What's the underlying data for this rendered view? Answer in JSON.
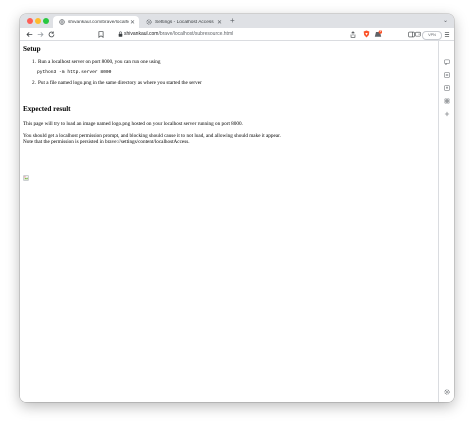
{
  "tabs": [
    {
      "title": "shivankaul.com/brave/localhost/subresource.html",
      "active": true
    },
    {
      "title": "Settings - Localhost Access",
      "active": false
    }
  ],
  "toolbar": {
    "url_host": "shivankaul.com",
    "url_path": "/brave/localhost/subresource.html",
    "vpn_label": "VPN",
    "shields_badge": "1"
  },
  "page": {
    "setup_heading": "Setup",
    "steps": [
      {
        "num": "1.",
        "text": "Run a localhost server on port 8000, you can run one using"
      },
      {
        "num": "2.",
        "text": "Put a file named logo.png in the same directory as where you started the server"
      }
    ],
    "command": "python3 -m http.server 8000",
    "expected_heading": "Expected result",
    "para1": "This page will try to load an image named logo.png hosted on your localhost server running on port 8000.",
    "para2_line1": "You should get a localhost permission prompt, and blocking should cause it to not load, and allowing should make it appear.",
    "para2_line2": "Note that the permission is persisted in brave://settings/content/localhostAccess."
  },
  "colors": {
    "tabstrip": "#dfe1e5",
    "brave_orange": "#fb542b"
  }
}
